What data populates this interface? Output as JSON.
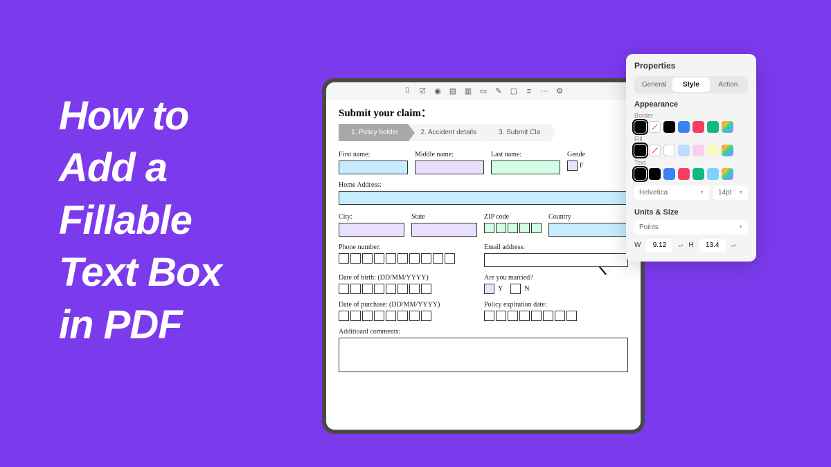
{
  "title_lines": [
    "How to",
    "Add a",
    "Fillable",
    "Text Box",
    "in PDF"
  ],
  "form": {
    "title": "Submit your claim：",
    "steps": [
      "1. Policy holder",
      "2. Accident details",
      "3. Submit Cla"
    ],
    "first_name": "First name:",
    "middle_name": "Middle name:",
    "last_name": "Last name:",
    "gender": "Gende",
    "gender_f": "F",
    "home_address": "Home Address:",
    "city": "City:",
    "state": "State",
    "zip": "ZIP code",
    "country": "Country",
    "phone": "Phone number:",
    "email": "Email address:",
    "dob": "Date of birth: (DD/MM/YYYY)",
    "married": "Are you married?",
    "married_y": "Y",
    "married_n": "N",
    "dop": "Date of purchase: (DD/MM/YYYY)",
    "exp": "Policy expiration date:",
    "comments": "Additioanl comments:"
  },
  "panel": {
    "title": "Properties",
    "tabs": [
      "General",
      "Style",
      "Action"
    ],
    "appearance": "Appearance",
    "border": "Border",
    "fill": "Fill",
    "text": "Text",
    "font": "Helvetica",
    "size": "14pt",
    "units_size": "Units & Size",
    "units": "Points",
    "w": "W",
    "h": "H",
    "wv": "9.12",
    "hv": "13.4"
  },
  "colors": {
    "border": [
      "#000",
      "none",
      "#000",
      "#3b82f6",
      "#f43f5e",
      "#10b981",
      "grad"
    ],
    "fill": [
      "#000",
      "none",
      "#fff",
      "#bfdbfe",
      "#fbcfe8",
      "#fef9c3",
      "grad"
    ],
    "text": [
      "#000",
      "#000",
      "#3b82f6",
      "#f43f5e",
      "#10b981",
      "#7dd3fc",
      "grad"
    ]
  }
}
